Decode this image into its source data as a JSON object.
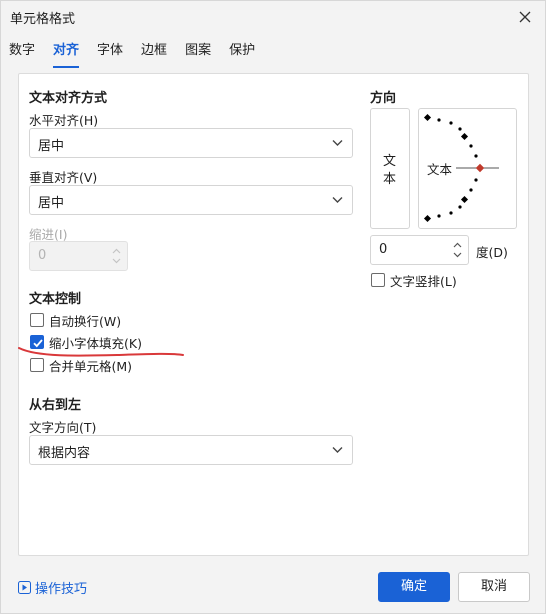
{
  "window": {
    "title": "单元格格式"
  },
  "tabs": [
    {
      "label": "数字",
      "active": false
    },
    {
      "label": "对齐",
      "active": true
    },
    {
      "label": "字体",
      "active": false
    },
    {
      "label": "边框",
      "active": false
    },
    {
      "label": "图案",
      "active": false
    },
    {
      "label": "保护",
      "active": false
    }
  ],
  "text_alignment": {
    "heading": "文本对齐方式",
    "horizontal_label": "水平对齐(H)",
    "horizontal_value": "居中",
    "vertical_label": "垂直对齐(V)",
    "vertical_value": "居中",
    "indent_label": "缩进(I)",
    "indent_value": "0"
  },
  "text_control": {
    "heading": "文本控制",
    "wrap_label": "自动换行(W)",
    "wrap_checked": false,
    "shrink_label": "缩小字体填充(K)",
    "shrink_checked": true,
    "merge_label": "合并单元格(M)",
    "merge_checked": false
  },
  "rtl": {
    "heading": "从右到左",
    "direction_label": "文字方向(T)",
    "direction_value": "根据内容"
  },
  "orientation": {
    "heading": "方向",
    "vertical_text": "文本",
    "dial_text": "文本",
    "degree_value": "0",
    "degree_label": "度(D)",
    "stacked_label": "文字竖排(L)",
    "stacked_checked": false
  },
  "footer": {
    "tips_label": "操作技巧",
    "ok_label": "确定",
    "cancel_label": "取消"
  },
  "colors": {
    "accent": "#1a62d6",
    "annotation": "#d9383a"
  }
}
